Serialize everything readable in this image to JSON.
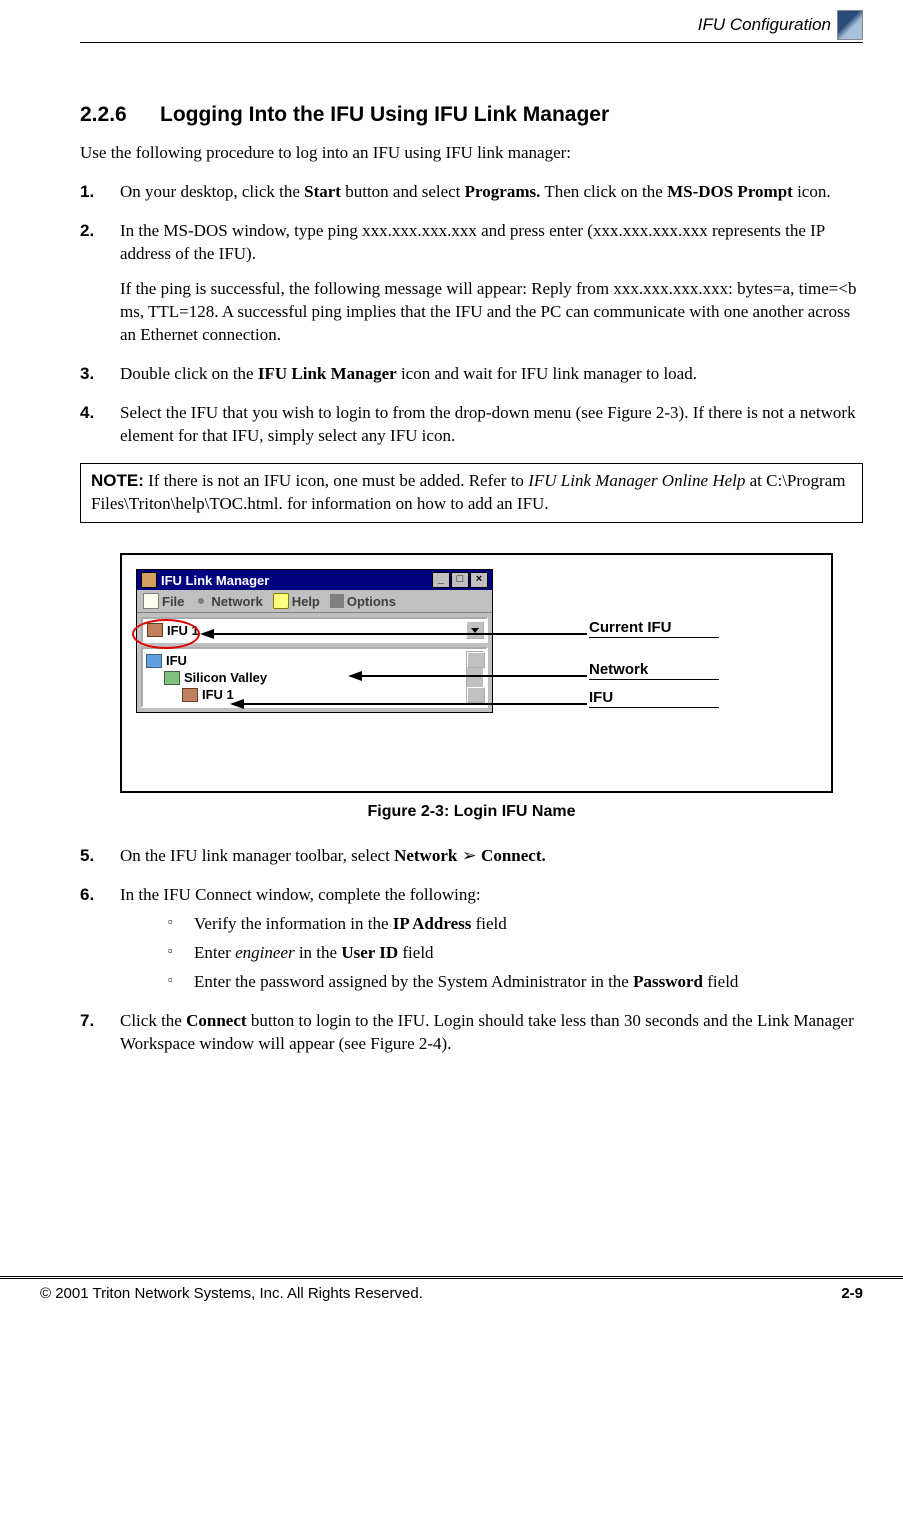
{
  "header": {
    "title": "IFU Configuration"
  },
  "section": {
    "number": "2.2.6",
    "title": "Logging Into the IFU Using IFU Link Manager"
  },
  "intro": "Use the following procedure to log into an IFU using IFU link manager:",
  "steps": {
    "s1": {
      "pre": "On your desktop, click the ",
      "b1": "Start",
      "mid1": " button and select ",
      "b2": "Programs.",
      "mid2": " Then click on the ",
      "b3": "MS-DOS Prompt",
      "post": " icon."
    },
    "s2": {
      "p1": "In the MS-DOS window, type ping xxx.xxx.xxx.xxx and press enter (xxx.xxx.xxx.xxx represents the IP address of the IFU).",
      "p2": "If the ping is successful, the following message will appear: Reply from xxx.xxx.xxx.xxx: bytes=a, time=<b ms, TTL=128. A successful ping implies that the IFU and the PC can communicate with one another across an Ethernet connection."
    },
    "s3": {
      "pre": "Double click on the ",
      "b1": "IFU Link Manager",
      "post": " icon and wait for IFU link manager to load."
    },
    "s4": {
      "text": "Select the IFU that you wish to login to from the drop-down menu (see Figure 2-3). If there is not a network element for that IFU, simply select any IFU icon."
    },
    "s5": {
      "pre": "On the IFU link manager toolbar, select ",
      "b1": "Network",
      "arrow": " ➢ ",
      "b2": "Connect."
    },
    "s6": {
      "text": "In the IFU Connect window, complete the following:",
      "a": {
        "pre": "Verify the information in the ",
        "b": "IP Address",
        "post": " field"
      },
      "b": {
        "pre": "Enter ",
        "i": "engineer",
        "mid": " in the ",
        "bo": "User ID",
        "post": " field"
      },
      "c": {
        "pre": "Enter the password assigned by the System Administrator in the ",
        "b": "Password",
        "post": " field"
      }
    },
    "s7": {
      "pre": "Click the ",
      "b1": "Connect",
      "post": " button to login to the IFU. Login should take less than 30 seconds and the Link Manager Workspace window will appear (see Figure 2-4)."
    }
  },
  "note": {
    "label": "NOTE:",
    "pre": "  If there is not an IFU icon, one must be added. Refer to ",
    "i": "IFU Link Manager Online Help",
    "post": " at C:\\Program Files\\Triton\\help\\TOC.html. for information on how to add an IFU."
  },
  "figure": {
    "caption": "Figure 2-3:    Login IFU Name",
    "window_title": "IFU Link Manager",
    "menu": {
      "file": "File",
      "network": "Network",
      "help": "Help",
      "options": "Options"
    },
    "dropdown": "IFU 1",
    "tree": {
      "root": "IFU",
      "group": "Silicon Valley",
      "leaf": "IFU 1"
    },
    "callouts": {
      "c1": "Current IFU",
      "c2": "Network",
      "c3": "IFU"
    }
  },
  "footer": {
    "left": "© 2001 Triton Network Systems, Inc. All Rights Reserved.",
    "right": "2-9"
  }
}
